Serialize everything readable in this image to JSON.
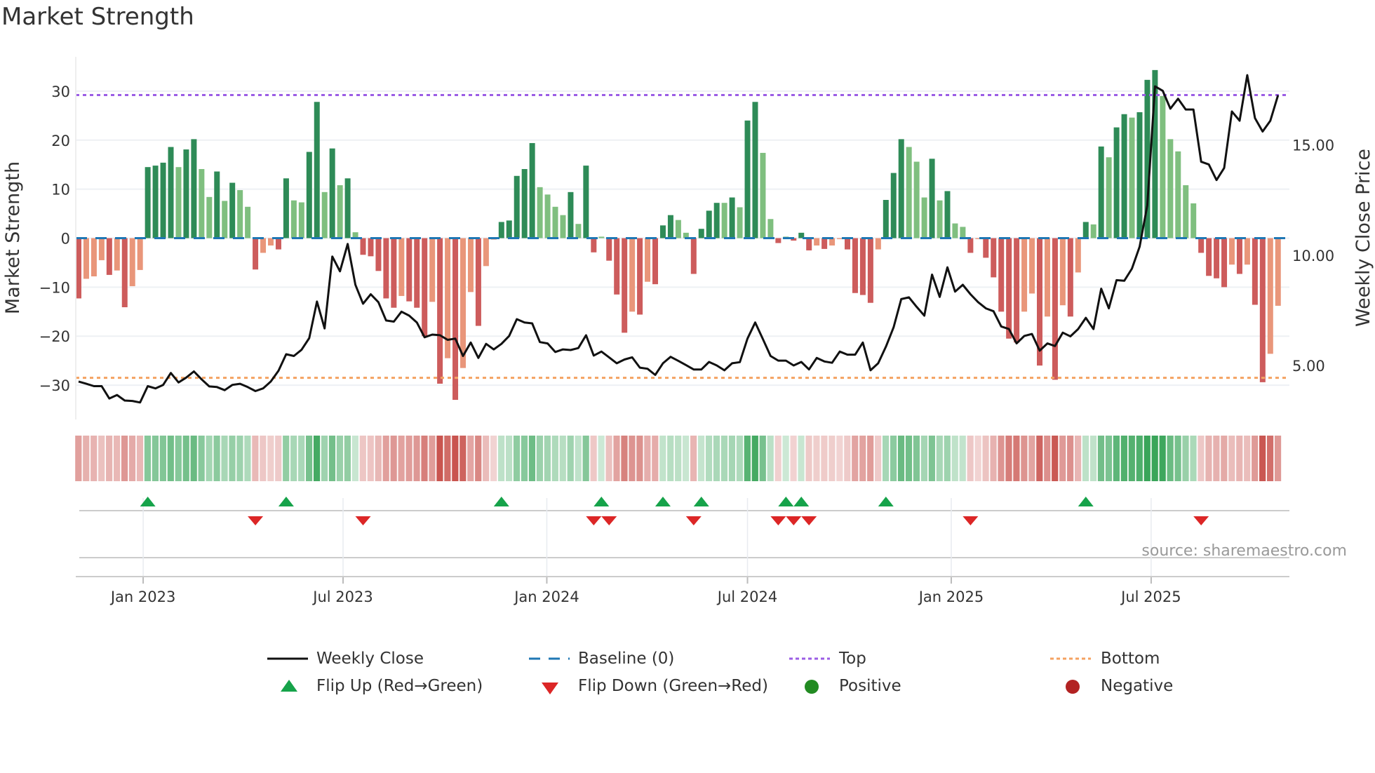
{
  "chart_data": {
    "type": "bar",
    "title": "Market Strength",
    "ylabel": "Market Strength",
    "y2label": "Weekly Close Price",
    "ylim": [
      -37,
      37
    ],
    "y2lim": [
      2.55,
      19.0
    ],
    "yticks": [
      30,
      20,
      10,
      0,
      -10,
      -20,
      -30
    ],
    "ytick_labels": [
      "30",
      "20",
      "10",
      "0",
      "−10",
      "−20",
      "−30"
    ],
    "y2ticks": [
      15,
      10,
      5
    ],
    "y2tick_labels": [
      "15.00",
      "10.00",
      "5.00"
    ],
    "xticks": [
      8.4,
      34.4,
      60.9,
      87.0,
      113.5,
      139.5
    ],
    "xtick_labels": [
      "Jan 2023",
      "Jul 2023",
      "Jan 2024",
      "Jul 2024",
      "Jan 2025",
      "Jul 2025"
    ],
    "top_level": 29.2,
    "bottom_level": -28.5,
    "strength": [
      -12.3,
      -8.3,
      -7.8,
      -4.5,
      -7.5,
      -6.6,
      -14.1,
      -9.8,
      -6.5,
      14.5,
      14.8,
      15.4,
      18.6,
      14.5,
      18.1,
      20.2,
      14.1,
      8.4,
      13.6,
      7.6,
      11.3,
      9.8,
      6.4,
      -6.4,
      -3,
      -1.5,
      -2.3,
      12.2,
      7.7,
      7.3,
      17.6,
      27.8,
      9.4,
      18.3,
      10.8,
      12.2,
      1.2,
      -3.4,
      -3.7,
      -6.7,
      -12.3,
      -14.2,
      -11.8,
      -12.9,
      -14.2,
      -20,
      -13,
      -29.7,
      -24.5,
      -33,
      -26.5,
      -11,
      -17.9,
      -5.7,
      -0.3,
      3.3,
      3.6,
      12.7,
      14.1,
      19.4,
      10.4,
      8.9,
      6.4,
      4.7,
      9.4,
      2.9,
      14.8,
      -2.9,
      0.3,
      -4.6,
      -11.5,
      -19.3,
      -15,
      -15.6,
      -8.9,
      -9.4,
      2.6,
      4.7,
      3.7,
      1.1,
      -7.3,
      1.9,
      5.6,
      7.2,
      7.2,
      8.3,
      6.3,
      24,
      27.8,
      17.4,
      3.9,
      -1,
      0.3,
      -0.5,
      1.1,
      -2.5,
      -1.5,
      -2.2,
      -1.5,
      -0.2,
      -2.3,
      -11.2,
      -11.6,
      -13.2,
      -2.3,
      7.8,
      13.3,
      20.2,
      18.6,
      15.6,
      8.3,
      16.2,
      7.7,
      9.6,
      3,
      2.3,
      -3,
      -0.2,
      -4,
      -8,
      -15,
      -20.5,
      -21.3,
      -15,
      -11.3,
      -26,
      -16,
      -28.9,
      -13.7,
      -16,
      -7,
      3.3,
      2.8,
      18.7,
      16.5,
      22.6,
      25.3,
      24.6,
      25.7,
      32.3,
      34.3,
      29,
      20.2,
      17.7,
      10.8,
      7.1,
      -3,
      -7.7,
      -8.2,
      -10,
      -5.4,
      -7.3,
      -5.4,
      -13.6,
      -29.4,
      -23.6,
      -13.8
    ],
    "strong": [
      1,
      0,
      0,
      0,
      1,
      0,
      1,
      0,
      0,
      1,
      1,
      1,
      1,
      0,
      1,
      1,
      0,
      0,
      1,
      0,
      1,
      0,
      0,
      1,
      0,
      0,
      1,
      1,
      0,
      0,
      1,
      1,
      0,
      1,
      0,
      1,
      0,
      1,
      1,
      1,
      1,
      1,
      0,
      1,
      1,
      1,
      0,
      1,
      0,
      1,
      0,
      0,
      1,
      0,
      0,
      1,
      1,
      1,
      1,
      1,
      0,
      0,
      0,
      0,
      1,
      0,
      1,
      1,
      0,
      1,
      1,
      1,
      0,
      1,
      0,
      1,
      1,
      1,
      0,
      0,
      1,
      1,
      1,
      1,
      0,
      1,
      0,
      1,
      1,
      0,
      0,
      1,
      0,
      1,
      1,
      1,
      0,
      1,
      0,
      0,
      1,
      1,
      1,
      1,
      0,
      1,
      1,
      1,
      0,
      0,
      0,
      1,
      0,
      1,
      0,
      0,
      1,
      0,
      1,
      1,
      1,
      1,
      1,
      0,
      0,
      1,
      0,
      1,
      0,
      1,
      0,
      1,
      0,
      1,
      0,
      1,
      1,
      0,
      1,
      1,
      1,
      0,
      0,
      0,
      0,
      0,
      1,
      1,
      1,
      1,
      0,
      1,
      0,
      1,
      1,
      0,
      0
    ],
    "weekly_close": [
      4.27,
      4.17,
      4.06,
      4.06,
      3.5,
      3.66,
      3.41,
      3.39,
      3.32,
      4.06,
      3.96,
      4.12,
      4.66,
      4.23,
      4.45,
      4.73,
      4.37,
      4.05,
      4.02,
      3.88,
      4.12,
      4.17,
      4.02,
      3.84,
      3.96,
      4.27,
      4.76,
      5.51,
      5.43,
      5.71,
      6.24,
      7.9,
      6.68,
      9.94,
      9.27,
      10.51,
      8.66,
      7.8,
      8.23,
      7.87,
      7.04,
      6.99,
      7.44,
      7.26,
      6.95,
      6.28,
      6.4,
      6.37,
      6.16,
      6.22,
      5.43,
      6.04,
      5.34,
      5.98,
      5.73,
      5.98,
      6.34,
      7.1,
      6.95,
      6.91,
      6.06,
      6.0,
      5.61,
      5.73,
      5.7,
      5.79,
      6.37,
      5.45,
      5.63,
      5.37,
      5.1,
      5.27,
      5.37,
      4.9,
      4.85,
      4.57,
      5.1,
      5.39,
      5.21,
      5.02,
      4.82,
      4.82,
      5.16,
      5.0,
      4.78,
      5.1,
      5.15,
      6.22,
      6.95,
      6.2,
      5.43,
      5.22,
      5.22,
      5.0,
      5.16,
      4.82,
      5.34,
      5.18,
      5.12,
      5.63,
      5.49,
      5.49,
      6.04,
      4.78,
      5.1,
      5.85,
      6.73,
      8.01,
      8.09,
      7.66,
      7.26,
      9.12,
      8.11,
      9.45,
      8.35,
      8.66,
      8.23,
      7.87,
      7.59,
      7.46,
      6.77,
      6.65,
      6.0,
      6.34,
      6.43,
      5.67,
      6.0,
      5.88,
      6.49,
      6.32,
      6.65,
      7.16,
      6.65,
      8.48,
      7.59,
      8.87,
      8.84,
      9.39,
      10.39,
      12.26,
      17.66,
      17.46,
      16.65,
      17.1,
      16.61,
      16.61,
      14.24,
      14.12,
      13.41,
      13.96,
      16.52,
      16.1,
      18.17,
      16.22,
      15.61,
      16.1,
      17.26
    ],
    "flip_up": [
      10,
      28,
      56,
      69,
      77,
      82,
      93,
      95,
      106,
      132
    ],
    "flip_down": [
      24,
      38,
      68,
      70,
      81,
      92,
      94,
      96,
      117,
      147
    ],
    "colors": {
      "pos_strong": "#2e8b57",
      "pos_weak": "#7fbf7f",
      "neg_strong": "#cd5c5c",
      "neg_weak": "#e9967a",
      "line": "#111111",
      "baseline": "#1f77b4",
      "top": "#9b5de5",
      "bottom": "#f4a261",
      "flip_up": "#16a34a",
      "flip_down": "#dc2626",
      "positive": "#228b22",
      "negative": "#b22222",
      "grid": "#eef0f4"
    },
    "legend": {
      "weekly_close": "Weekly Close",
      "baseline": "Baseline (0)",
      "top": "Top",
      "bottom": "Bottom",
      "flip_up": "Flip Up (Red→Green)",
      "flip_down": "Flip Down (Green→Red)",
      "positive": "Positive",
      "negative": "Negative"
    },
    "source": "source: sharemaestro.com"
  }
}
